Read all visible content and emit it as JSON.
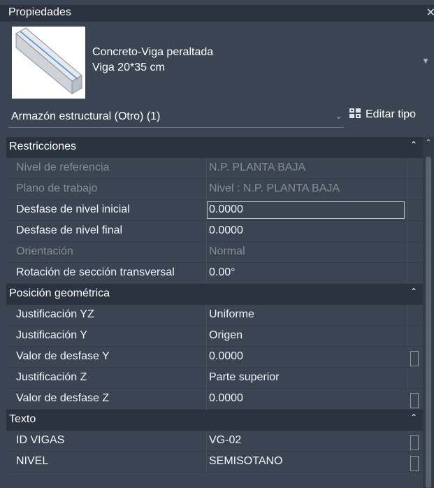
{
  "panel": {
    "title": "Propiedades"
  },
  "type_selector": {
    "family": "Concreto-Viga peraltada",
    "type": "Viga 20*35 cm"
  },
  "filter": {
    "label": "Armazón estructural (Otro) (1)",
    "edit_type": "Editar tipo"
  },
  "groups": [
    {
      "title": "Restricciones",
      "rows": [
        {
          "name": "Nivel de referencia",
          "value": "N.P. PLANTA BAJA"
        },
        {
          "name": "Plano de trabajo",
          "value": "Nivel : N.P. PLANTA BAJA"
        },
        {
          "name": "Desfase de nivel inicial",
          "value": "0.0000"
        },
        {
          "name": "Desfase de nivel final",
          "value": "0.0000"
        },
        {
          "name": "Orientación",
          "value": "Normal"
        },
        {
          "name": "Rotación de sección transversal",
          "value": "0.00°"
        }
      ]
    },
    {
      "title": "Posición geométrica",
      "rows": [
        {
          "name": "Justificación YZ",
          "value": "Uniforme"
        },
        {
          "name": "Justificación Y",
          "value": "Origen"
        },
        {
          "name": "Valor de desfase Y",
          "value": "0.0000"
        },
        {
          "name": "Justificación Z",
          "value": "Parte superior"
        },
        {
          "name": "Valor de desfase Z",
          "value": "0.0000"
        }
      ]
    },
    {
      "title": "Texto",
      "rows": [
        {
          "name": "ID VIGAS",
          "value": "VG-02"
        },
        {
          "name": "NIVEL",
          "value": "SEMISOTANO"
        }
      ]
    }
  ]
}
